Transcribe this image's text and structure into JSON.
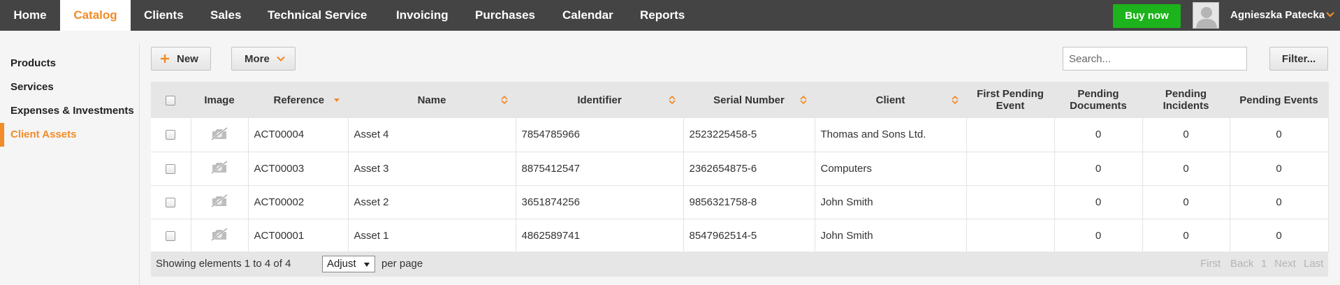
{
  "nav": {
    "items": [
      {
        "label": "Home",
        "name": "nav-home"
      },
      {
        "label": "Catalog",
        "name": "nav-catalog",
        "active": true
      },
      {
        "label": "Clients",
        "name": "nav-clients"
      },
      {
        "label": "Sales",
        "name": "nav-sales"
      },
      {
        "label": "Technical Service",
        "name": "nav-technical-service"
      },
      {
        "label": "Invoicing",
        "name": "nav-invoicing"
      },
      {
        "label": "Purchases",
        "name": "nav-purchases"
      },
      {
        "label": "Calendar",
        "name": "nav-calendar"
      },
      {
        "label": "Reports",
        "name": "nav-reports"
      }
    ],
    "buy_label": "Buy now",
    "user_name": "Agnieszka Patecka"
  },
  "sidebar": {
    "items": [
      {
        "label": "Products"
      },
      {
        "label": "Services"
      },
      {
        "label": "Expenses & Investments"
      },
      {
        "label": "Client Assets",
        "active": true
      }
    ]
  },
  "toolbar": {
    "new_label": "New",
    "more_label": "More",
    "search_placeholder": "Search...",
    "filter_label": "Filter..."
  },
  "table": {
    "headers": {
      "image": "Image",
      "reference": "Reference",
      "name": "Name",
      "identifier": "Identifier",
      "serial": "Serial Number",
      "client": "Client",
      "first_pending": "First Pending Event",
      "pending_docs": "Pending Documents",
      "pending_incidents": "Pending Incidents",
      "pending_events": "Pending Events"
    },
    "rows": [
      {
        "reference": "ACT00004",
        "name": "Asset 4",
        "identifier": "7854785966",
        "serial": "2523225458-5",
        "client": "Thomas and Sons Ltd.",
        "first_pending": "",
        "pending_docs": "0",
        "pending_incidents": "0",
        "pending_events": "0"
      },
      {
        "reference": "ACT00003",
        "name": "Asset 3",
        "identifier": "8875412547",
        "serial": "2362654875-6",
        "client": "Computers",
        "first_pending": "",
        "pending_docs": "0",
        "pending_incidents": "0",
        "pending_events": "0"
      },
      {
        "reference": "ACT00002",
        "name": "Asset 2",
        "identifier": "3651874256",
        "serial": "9856321758-8",
        "client": "John Smith",
        "first_pending": "",
        "pending_docs": "0",
        "pending_incidents": "0",
        "pending_events": "0"
      },
      {
        "reference": "ACT00001",
        "name": "Asset 1",
        "identifier": "4862589741",
        "serial": "8547962514-5",
        "client": "John Smith",
        "first_pending": "",
        "pending_docs": "0",
        "pending_incidents": "0",
        "pending_events": "0"
      }
    ]
  },
  "footer": {
    "showing": "Showing elements 1 to 4 of 4",
    "per_page_value": "Adjust",
    "per_page_label": "per page",
    "pager": {
      "first": "First",
      "back": "Back",
      "page": "1",
      "next": "Next",
      "last": "Last"
    }
  },
  "colors": {
    "accent": "#f28c28",
    "nav_bg": "#444444",
    "buy": "#1db31d"
  }
}
